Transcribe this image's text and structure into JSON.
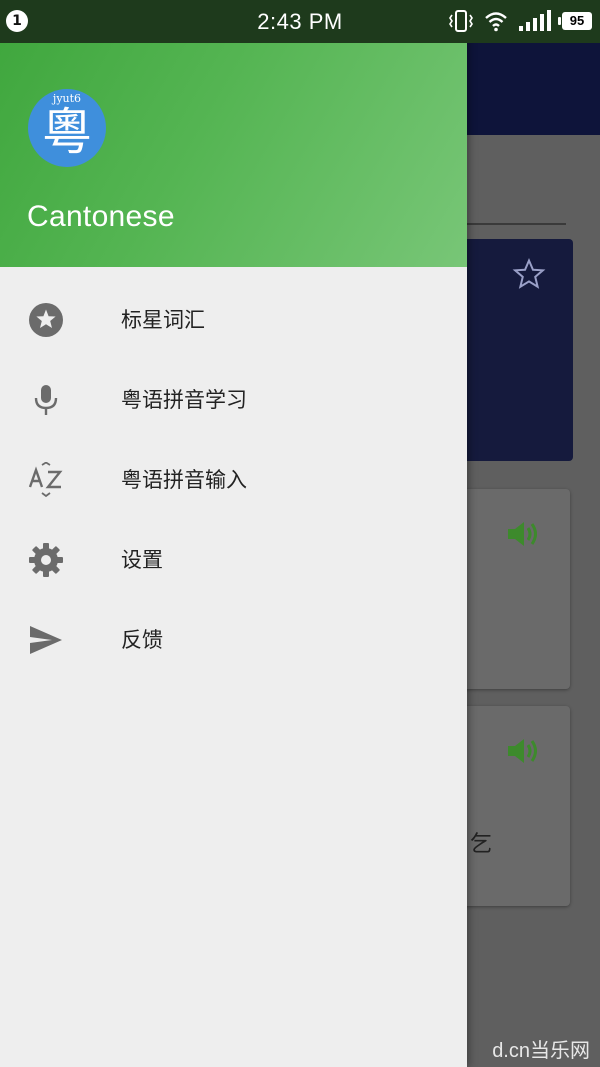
{
  "status_bar": {
    "notification_count": "1",
    "time": "2:43 PM",
    "battery_level": "95",
    "icons": [
      "vibrate-icon",
      "wifi-icon",
      "signal-icon",
      "battery-icon"
    ]
  },
  "drawer": {
    "logo": {
      "romanization": "jyut6",
      "character": "粵",
      "color": "#3f8fdc"
    },
    "app_name": "Cantonese",
    "header_colors": [
      "#3ea63c",
      "#78c677"
    ],
    "items": [
      {
        "label": "标星词汇",
        "icon": "star-icon"
      },
      {
        "label": "粤语拼音学习",
        "icon": "microphone-icon"
      },
      {
        "label": "粤语拼音输入",
        "icon": "a-z-sort-icon"
      },
      {
        "label": "设置",
        "icon": "gear-icon"
      },
      {
        "label": "反馈",
        "icon": "send-icon"
      }
    ]
  },
  "background": {
    "toolbar_color": "#0e143a",
    "accent_green": "#3d8a2c",
    "text_fragment": "乞"
  },
  "watermark": "d.cn当乐网"
}
